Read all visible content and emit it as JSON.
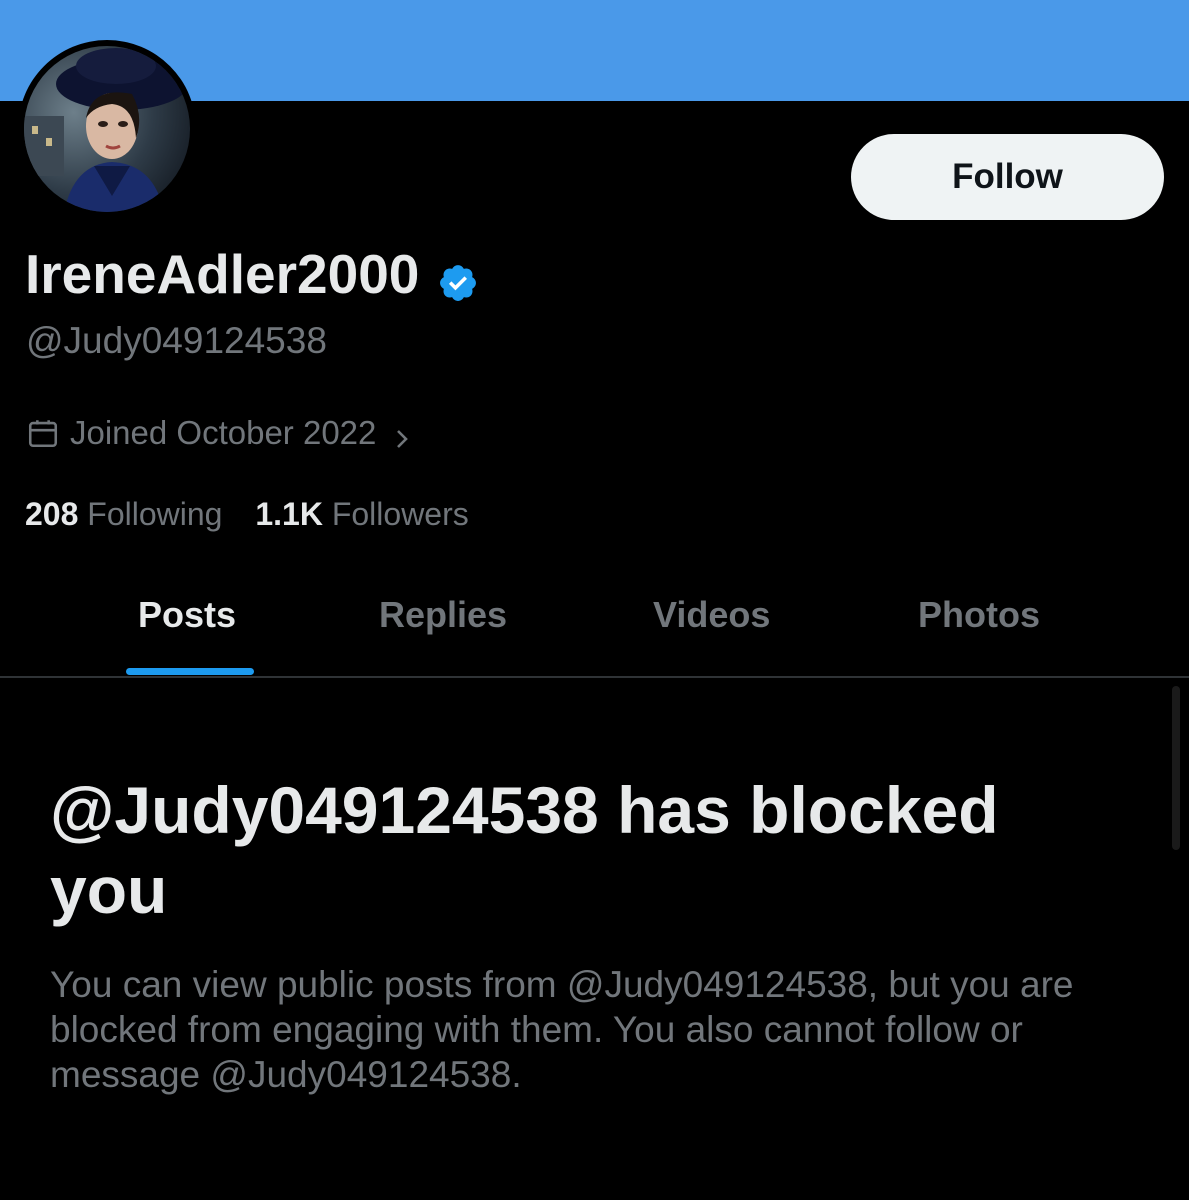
{
  "profile": {
    "display_name": "IreneAdler2000",
    "handle": "@Judy049124538",
    "joined": "Joined October 2022",
    "follow_label": "Follow",
    "stats": {
      "following_count": "208",
      "following_label": "Following",
      "followers_count": "1.1K",
      "followers_label": "Followers"
    }
  },
  "tabs": [
    "Posts",
    "Replies",
    "Videos",
    "Photos"
  ],
  "active_tab": "Posts",
  "blocked": {
    "title": "@Judy049124538 has blocked you",
    "description": "You can view public posts from @Judy049124538, but you are blocked from engaging with them. You also cannot follow or message @Judy049124538."
  },
  "icons": {
    "verified": "verified-badge-icon",
    "calendar": "calendar-icon",
    "chevron": "chevron-right-icon"
  },
  "colors": {
    "banner": "#4a99e9",
    "accent": "#1d9bf0",
    "background": "#000000",
    "text_primary": "#e7e9ea",
    "text_secondary": "#71767b"
  }
}
